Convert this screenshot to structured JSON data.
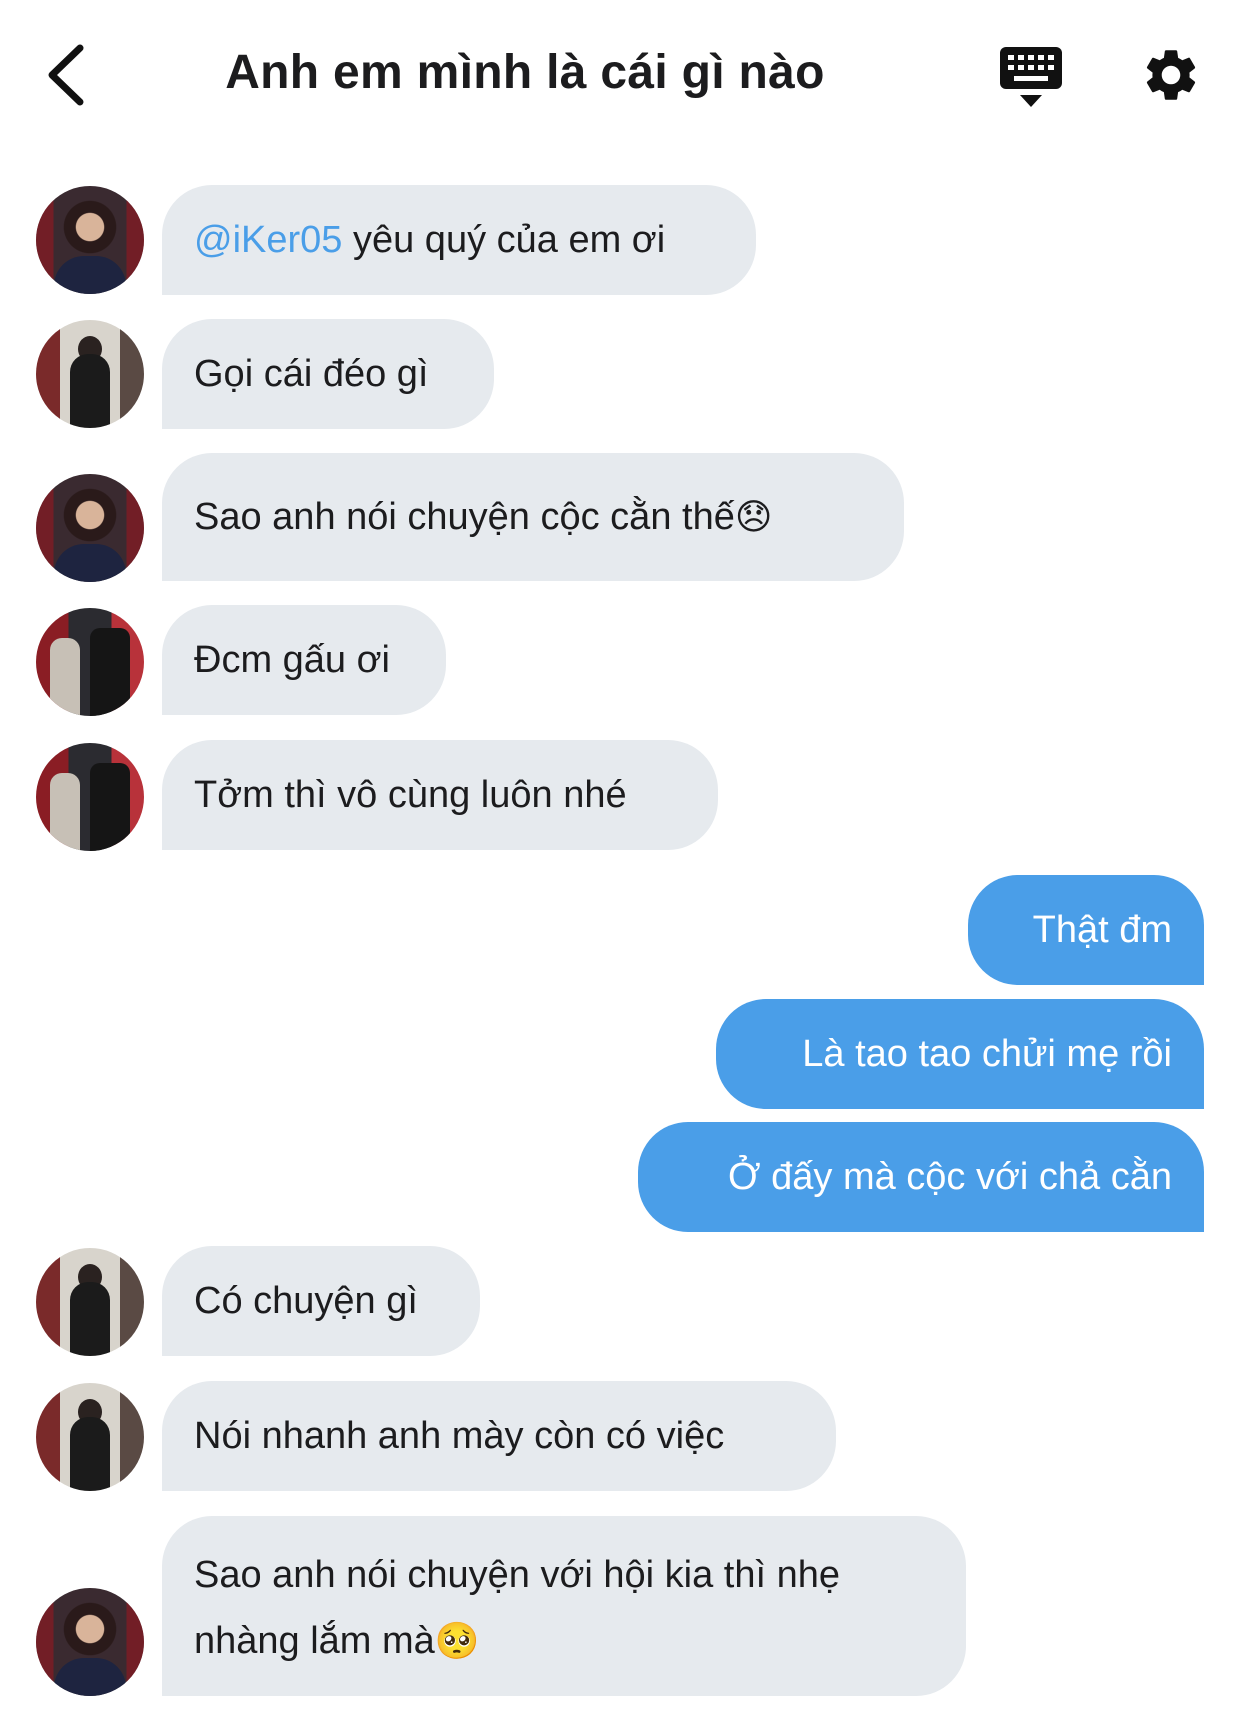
{
  "header": {
    "title": "Anh em mình là cái gì nào",
    "back_icon": "chevron-left-icon",
    "keyboard_icon": "keyboard-icon",
    "settings_icon": "gear-icon"
  },
  "messages": [
    {
      "side": "in",
      "avatar": "avatar-a",
      "mention": "@iKer05",
      "text": " yêu quý của em ơi"
    },
    {
      "side": "in",
      "avatar": "avatar-b",
      "text": "Gọi cái đéo gì"
    },
    {
      "side": "in",
      "avatar": "avatar-a",
      "text": "Sao anh nói chuyện cộc cằn thế",
      "emoji": "😞"
    },
    {
      "side": "in",
      "avatar": "avatar-c",
      "text": "Đcm gấu ơi"
    },
    {
      "side": "in",
      "avatar": "avatar-c",
      "text": "Tởm thì vô cùng luôn nhé"
    },
    {
      "side": "out",
      "text": "Thật đm"
    },
    {
      "side": "out",
      "text": "Là tao tao chửi mẹ rồi"
    },
    {
      "side": "out",
      "text": "Ở đấy mà cộc với chả cằn"
    },
    {
      "side": "in",
      "avatar": "avatar-b",
      "text": "Có chuyện gì"
    },
    {
      "side": "in",
      "avatar": "avatar-b",
      "text": "Nói nhanh anh mày còn có việc"
    },
    {
      "side": "in",
      "avatar": "avatar-a",
      "line1": "Sao anh nói chuyện với hội kia thì nhẹ",
      "line2": "nhàng lắm mà",
      "emoji": "🥺"
    }
  ],
  "colors": {
    "incoming_bubble": "#e6eaee",
    "outgoing_bubble": "#4a9ee8",
    "mention": "#4a9ee8"
  }
}
